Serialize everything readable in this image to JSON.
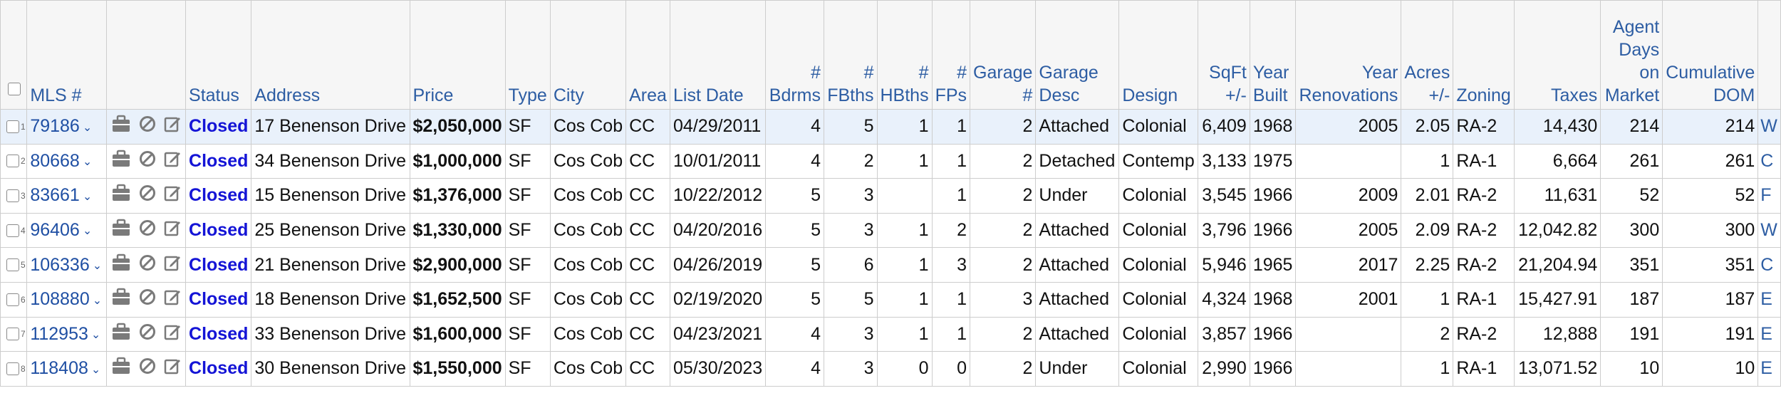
{
  "headers": {
    "mls": "MLS #",
    "status": "Status",
    "address": "Address",
    "price": "Price",
    "type": "Type",
    "city": "City",
    "area": "Area",
    "list_date": "List Date",
    "bdrms": "# Bdrms",
    "fbths": "# FBths",
    "hbths": "# HBths",
    "fps": "# FPs",
    "garage_num": "Garage #",
    "garage_desc": "Garage Desc",
    "design": "Design",
    "sqft": "SqFt +/-",
    "year_built": "Year Built",
    "year_renovations": "Year Renovations",
    "acres": "Acres +/-",
    "zoning": "Zoning",
    "taxes": "Taxes",
    "agent_dom": "Agent Days on Market",
    "cumulative_dom": "Cumulative DOM"
  },
  "icons": [
    "briefcase-icon",
    "cancel-icon",
    "edit-icon",
    "chevron-down-icon"
  ],
  "colors": {
    "status": "#1414d6",
    "link": "#1f4fa3",
    "header_text": "#2d5da3",
    "selected_row": "#e9f1fb"
  },
  "rows": [
    {
      "num": "1",
      "mls": "79186",
      "status": "Closed",
      "address": "17 Benenson Drive",
      "price": "$2,050,000",
      "type": "SF",
      "city": "Cos Cob",
      "area": "CC",
      "list_date": "04/29/2011",
      "bdrms": "4",
      "fbths": "5",
      "hbths": "1",
      "fps": "1",
      "garage_num": "2",
      "garage_desc": "Attached",
      "design": "Colonial",
      "sqft": "6,409",
      "year_built": "1968",
      "year_renovations": "2005",
      "acres": "2.05",
      "zoning": "RA-2",
      "taxes": "14,430",
      "agent_dom": "214",
      "cumulative_dom": "214",
      "cut": "W"
    },
    {
      "num": "2",
      "mls": "80668",
      "status": "Closed",
      "address": "34 Benenson Drive",
      "price": "$1,000,000",
      "type": "SF",
      "city": "Cos Cob",
      "area": "CC",
      "list_date": "10/01/2011",
      "bdrms": "4",
      "fbths": "2",
      "hbths": "1",
      "fps": "1",
      "garage_num": "2",
      "garage_desc": "Detached",
      "design": "Contemp",
      "sqft": "3,133",
      "year_built": "1975",
      "year_renovations": "",
      "acres": "1",
      "zoning": "RA-1",
      "taxes": "6,664",
      "agent_dom": "261",
      "cumulative_dom": "261",
      "cut": "C"
    },
    {
      "num": "3",
      "mls": "83661",
      "status": "Closed",
      "address": "15 Benenson Drive",
      "price": "$1,376,000",
      "type": "SF",
      "city": "Cos Cob",
      "area": "CC",
      "list_date": "10/22/2012",
      "bdrms": "5",
      "fbths": "3",
      "hbths": "",
      "fps": "1",
      "garage_num": "2",
      "garage_desc": "Under",
      "design": "Colonial",
      "sqft": "3,545",
      "year_built": "1966",
      "year_renovations": "2009",
      "acres": "2.01",
      "zoning": "RA-2",
      "taxes": "11,631",
      "agent_dom": "52",
      "cumulative_dom": "52",
      "cut": "F"
    },
    {
      "num": "4",
      "mls": "96406",
      "status": "Closed",
      "address": "25 Benenson Drive",
      "price": "$1,330,000",
      "type": "SF",
      "city": "Cos Cob",
      "area": "CC",
      "list_date": "04/20/2016",
      "bdrms": "5",
      "fbths": "3",
      "hbths": "1",
      "fps": "2",
      "garage_num": "2",
      "garage_desc": "Attached",
      "design": "Colonial",
      "sqft": "3,796",
      "year_built": "1966",
      "year_renovations": "2005",
      "acres": "2.09",
      "zoning": "RA-2",
      "taxes": "12,042.82",
      "agent_dom": "300",
      "cumulative_dom": "300",
      "cut": "W"
    },
    {
      "num": "5",
      "mls": "106336",
      "status": "Closed",
      "address": "21 Benenson Drive",
      "price": "$2,900,000",
      "type": "SF",
      "city": "Cos Cob",
      "area": "CC",
      "list_date": "04/26/2019",
      "bdrms": "5",
      "fbths": "6",
      "hbths": "1",
      "fps": "3",
      "garage_num": "2",
      "garage_desc": "Attached",
      "design": "Colonial",
      "sqft": "5,946",
      "year_built": "1965",
      "year_renovations": "2017",
      "acres": "2.25",
      "zoning": "RA-2",
      "taxes": "21,204.94",
      "agent_dom": "351",
      "cumulative_dom": "351",
      "cut": "C"
    },
    {
      "num": "6",
      "mls": "108880",
      "status": "Closed",
      "address": "18 Benenson Drive",
      "price": "$1,652,500",
      "type": "SF",
      "city": "Cos Cob",
      "area": "CC",
      "list_date": "02/19/2020",
      "bdrms": "5",
      "fbths": "5",
      "hbths": "1",
      "fps": "1",
      "garage_num": "3",
      "garage_desc": "Attached",
      "design": "Colonial",
      "sqft": "4,324",
      "year_built": "1968",
      "year_renovations": "2001",
      "acres": "1",
      "zoning": "RA-1",
      "taxes": "15,427.91",
      "agent_dom": "187",
      "cumulative_dom": "187",
      "cut": "E"
    },
    {
      "num": "7",
      "mls": "112953",
      "status": "Closed",
      "address": "33 Benenson Drive",
      "price": "$1,600,000",
      "type": "SF",
      "city": "Cos Cob",
      "area": "CC",
      "list_date": "04/23/2021",
      "bdrms": "4",
      "fbths": "3",
      "hbths": "1",
      "fps": "1",
      "garage_num": "2",
      "garage_desc": "Attached",
      "design": "Colonial",
      "sqft": "3,857",
      "year_built": "1966",
      "year_renovations": "",
      "acres": "2",
      "zoning": "RA-2",
      "taxes": "12,888",
      "agent_dom": "191",
      "cumulative_dom": "191",
      "cut": "E"
    },
    {
      "num": "8",
      "mls": "118408",
      "status": "Closed",
      "address": "30 Benenson Drive",
      "price": "$1,550,000",
      "type": "SF",
      "city": "Cos Cob",
      "area": "CC",
      "list_date": "05/30/2023",
      "bdrms": "4",
      "fbths": "3",
      "hbths": "0",
      "fps": "0",
      "garage_num": "2",
      "garage_desc": "Under",
      "design": "Colonial",
      "sqft": "2,990",
      "year_built": "1966",
      "year_renovations": "",
      "acres": "1",
      "zoning": "RA-1",
      "taxes": "13,071.52",
      "agent_dom": "10",
      "cumulative_dom": "10",
      "cut": "E"
    }
  ]
}
